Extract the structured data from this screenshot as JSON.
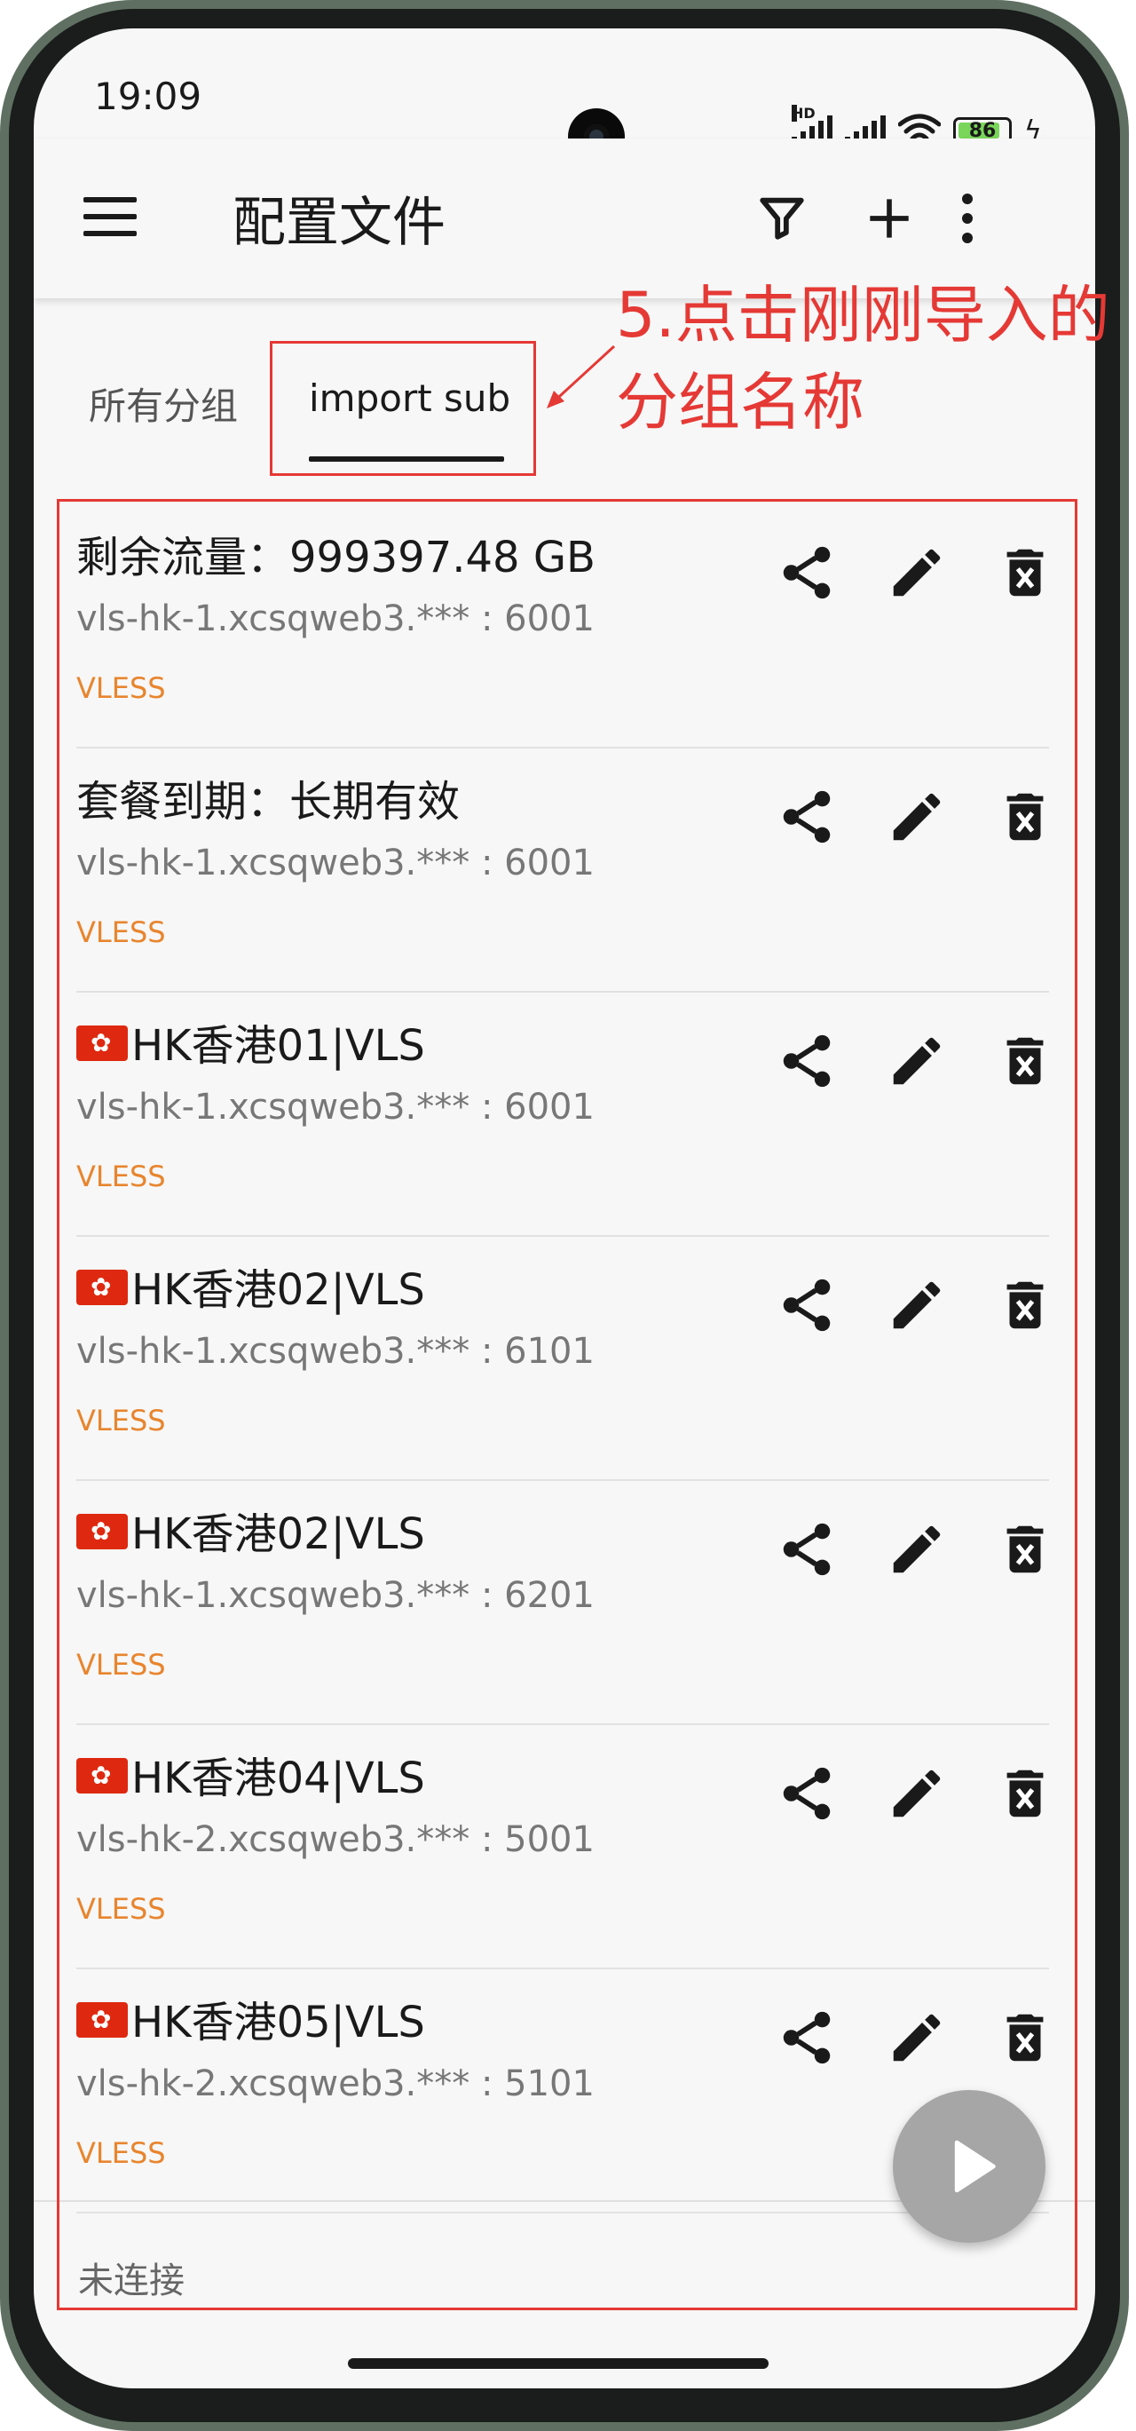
{
  "status_bar": {
    "time": "19:09",
    "signal_label": "HD",
    "battery_level": "86",
    "battery_percent": 86,
    "icons": [
      "hd-signal-icon",
      "signal-icon",
      "wifi-icon",
      "battery-icon",
      "charging-bolt-icon"
    ]
  },
  "app_bar": {
    "title": "配置文件",
    "icons": [
      "menu-icon",
      "filter-icon",
      "add-icon",
      "more-vert-icon"
    ]
  },
  "tabs": [
    {
      "label": "所有分组",
      "selected": false
    },
    {
      "label": "import sub",
      "selected": true
    }
  ],
  "annotation": {
    "text_line1": "5.点击刚刚导入的",
    "text_line2": "分组名称",
    "color": "#e53935"
  },
  "servers": [
    {
      "name": "剩余流量：999397.48 GB",
      "address": "vls-hk-1.xcsqweb3.*** : 6001",
      "type": "VLESS",
      "flag": false
    },
    {
      "name": "套餐到期：长期有效",
      "address": "vls-hk-1.xcsqweb3.*** : 6001",
      "type": "VLESS",
      "flag": false
    },
    {
      "name": "HK香港01|VLS",
      "address": "vls-hk-1.xcsqweb3.*** : 6001",
      "type": "VLESS",
      "flag": true
    },
    {
      "name": "HK香港02|VLS",
      "address": "vls-hk-1.xcsqweb3.*** : 6101",
      "type": "VLESS",
      "flag": true
    },
    {
      "name": "HK香港02|VLS",
      "address": "vls-hk-1.xcsqweb3.*** : 6201",
      "type": "VLESS",
      "flag": true
    },
    {
      "name": "HK香港04|VLS",
      "address": "vls-hk-2.xcsqweb3.*** : 5001",
      "type": "VLESS",
      "flag": true
    },
    {
      "name": "HK香港05|VLS",
      "address": "vls-hk-2.xcsqweb3.*** : 5101",
      "type": "VLESS",
      "flag": true
    }
  ],
  "item_actions": [
    "share-icon",
    "edit-icon",
    "delete-icon"
  ],
  "connection_status": "未连接",
  "fab_icon": "play-icon",
  "colors": {
    "accent": "#e8852e",
    "annotation": "#e53935",
    "fab": "#a6a6a6"
  }
}
